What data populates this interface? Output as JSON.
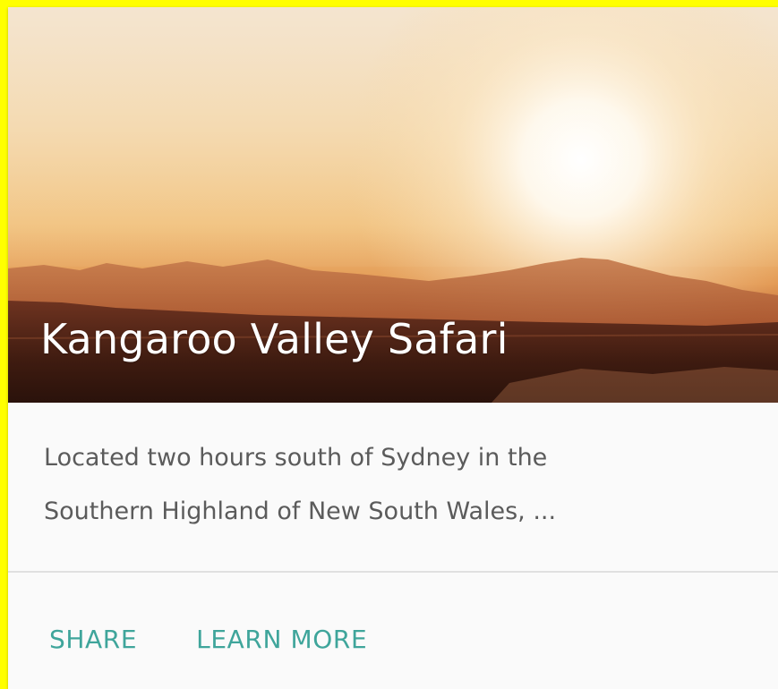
{
  "card": {
    "title": "Kangaroo Valley Safari",
    "supporting_text_line1": "Located two hours south of Sydney in the",
    "supporting_text_line2": "Southern Highland of New South Wales, ...",
    "actions": [
      {
        "label": "SHARE"
      },
      {
        "label": "LEARN MORE"
      }
    ]
  },
  "colors": {
    "page_background": "#ffff00",
    "card_background": "#fafafa",
    "title_text": "#ffffff",
    "supporting_text": "#5b5b5b",
    "action_text": "#3fa59b",
    "divider": "#e0e0e0"
  }
}
